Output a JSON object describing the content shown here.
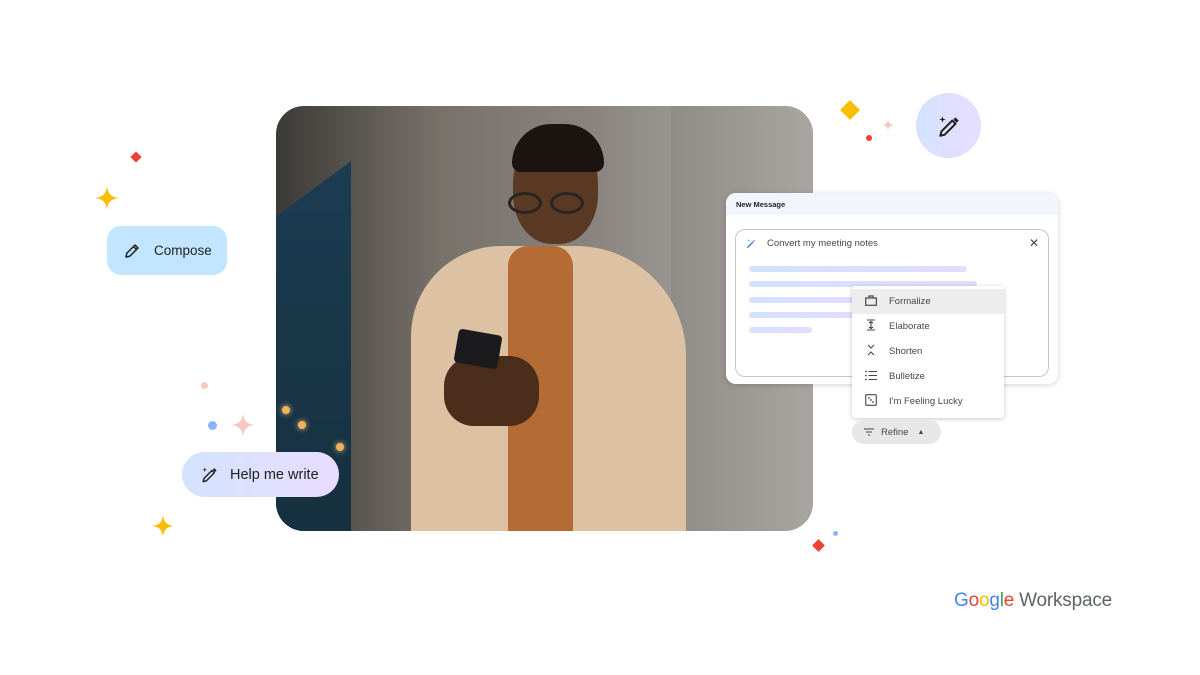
{
  "hero": {
    "alt": "Smiling man in glasses and trench coat using smartphone"
  },
  "chips": {
    "compose": {
      "label": "Compose",
      "icon": "pencil-icon"
    },
    "help_me_write": {
      "label": "Help me write",
      "icon": "magic-wand-icon"
    },
    "wand_button": {
      "icon": "magic-wand-icon"
    }
  },
  "message": {
    "title": "New Message",
    "prompt": "Convert my meeting notes",
    "prompt_icon": "magic-wand-icon",
    "close_icon": "close-icon"
  },
  "refine_menu": {
    "items": [
      {
        "label": "Formalize",
        "icon": "briefcase-icon",
        "glyph": "🗀",
        "active": true
      },
      {
        "label": "Elaborate",
        "icon": "expand-vertical-icon",
        "glyph": "⇕"
      },
      {
        "label": "Shorten",
        "icon": "compress-vertical-icon",
        "glyph": "⌄"
      },
      {
        "label": "Bulletize",
        "icon": "bulleted-list-icon",
        "glyph": "☰"
      },
      {
        "label": "I'm Feeling Lucky",
        "icon": "dice-icon",
        "glyph": "⚁"
      }
    ],
    "button_label": "Refine",
    "button_icon": "filter-icon"
  },
  "logo": {
    "google_letters": [
      {
        "ch": "G",
        "color": "#4285F4"
      },
      {
        "ch": "o",
        "color": "#EA4335"
      },
      {
        "ch": "o",
        "color": "#FBBC04"
      },
      {
        "ch": "g",
        "color": "#4285F4"
      },
      {
        "ch": "l",
        "color": "#34A853"
      },
      {
        "ch": "e",
        "color": "#EA4335"
      }
    ],
    "product": "Workspace"
  },
  "colors": {
    "compose_bg": "#c2e6ff",
    "spark_yellow": "#fbbc04",
    "spark_red": "#ea4335",
    "spark_blue": "#8ab4f8",
    "spark_pink": "#f6c9c5"
  }
}
